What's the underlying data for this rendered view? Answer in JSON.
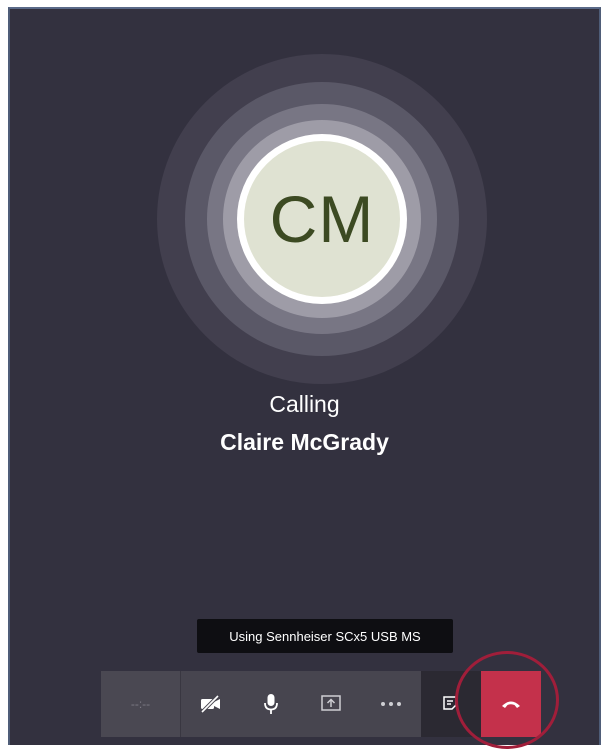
{
  "call": {
    "initials": "CM",
    "status": "Calling",
    "callee_name": "Claire McGrady"
  },
  "tooltip": {
    "text": "Using Sennheiser SCx5 USB MS"
  },
  "toolbar": {
    "timer": "--:--",
    "buttons": [
      {
        "icon": "video-off-icon",
        "label": "Turn camera on"
      },
      {
        "icon": "microphone-icon",
        "label": "Mute"
      },
      {
        "icon": "share-screen-icon",
        "label": "Share"
      },
      {
        "icon": "more-options-icon",
        "label": "More actions"
      },
      {
        "icon": "chat-icon",
        "label": "Show conversation"
      },
      {
        "icon": "hang-up-icon",
        "label": "Hang up"
      }
    ]
  },
  "colors": {
    "background": "#33313f",
    "avatar_fill": "#dfe2d2",
    "initials": "#3c4a22",
    "hangup": "#c4314b",
    "highlight": "#a01e3a"
  }
}
